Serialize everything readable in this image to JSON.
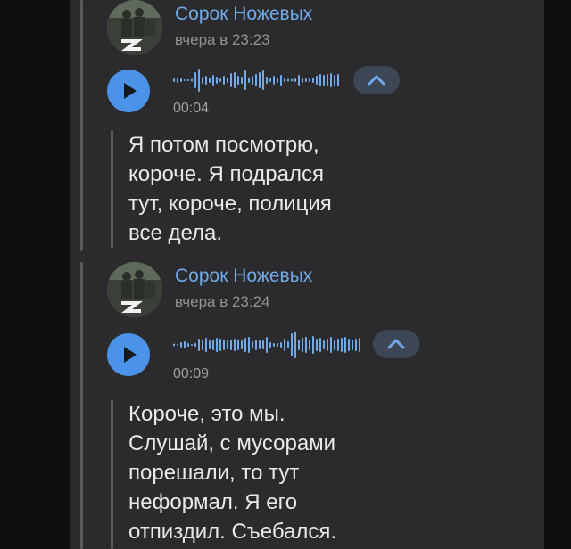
{
  "colors": {
    "accent": "#71aaeb",
    "play_button": "#4b93e8",
    "panel": "#2b2b2d",
    "text": "#e9e9ec",
    "muted": "#939396"
  },
  "messages": [
    {
      "author": "Сорок Ножевых",
      "time": "вчера в 23:23",
      "voice": {
        "duration": "00:04",
        "play_icon": "play-icon",
        "expand_icon": "chevron-up-icon"
      },
      "transcript_lines": [
        "Я потом посмотрю,",
        "короче. Я подрался",
        "тут, короче, полиция",
        "все дела."
      ]
    },
    {
      "author": "Сорок Ножевых",
      "time": "вчера в 23:24",
      "voice": {
        "duration": "00:09",
        "play_icon": "play-icon",
        "expand_icon": "chevron-up-icon"
      },
      "transcript_lines": [
        "Короче, это мы.",
        "Слушай, с мусорами",
        "порешали, то тут",
        "неформал. Я его",
        "отпиздил. Съебался."
      ]
    }
  ]
}
